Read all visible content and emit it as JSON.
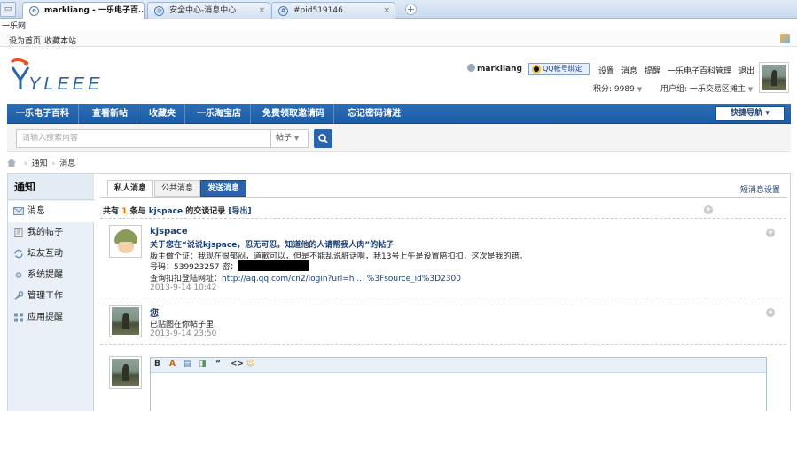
{
  "browser": {
    "tabs": [
      {
        "title": "markliang - 一乐电子百…",
        "favicon": "globe-icon"
      },
      {
        "title": "安全中心-消息中心",
        "favicon": "shield-icon"
      },
      {
        "title": "#pid519146",
        "favicon": "page-icon"
      }
    ],
    "new_tab_symbol": "+"
  },
  "site_title": "一乐网",
  "topnav": {
    "set_home": "设为首页",
    "bookmark": "收藏本站"
  },
  "logo": {
    "text": "YLEEE",
    "color": "#2a63a8",
    "accent": "#e8531f"
  },
  "user": {
    "name": "markliang",
    "qq_bind": "QQ帐号绑定",
    "links": [
      "设置",
      "消息",
      "提醒",
      "一乐电子百科管理",
      "退出"
    ],
    "points_label": "积分: 9989",
    "group_label": "用户组: 一乐交易区摊主"
  },
  "mainnav": {
    "items": [
      "一乐电子百科",
      "查看新帖",
      "收藏夹",
      "一乐淘宝店",
      "免费领取邀请码",
      "忘记密码请进"
    ],
    "quick": "快捷导航"
  },
  "search": {
    "placeholder": "请输入搜索内容",
    "type": "帖子"
  },
  "breadcrumb": [
    "通知",
    "消息"
  ],
  "sidebar": {
    "title": "通知",
    "items": [
      "消息",
      "我的帖子",
      "坛友互动",
      "系统提醒",
      "管理工作",
      "应用提醒"
    ]
  },
  "tabs": {
    "private": "私人消息",
    "public": "公共消息",
    "send": "发送消息",
    "settings": "短消息设置"
  },
  "summary": {
    "pre": "共有 ",
    "count": "1",
    "mid": " 条与 ",
    "user": "kjspace",
    "post": " 的交谈记录",
    "export": "[导出]"
  },
  "messages": [
    {
      "author": "kjspace",
      "title": "关于您在“说说kjspace，忍无可忍，知道他的人请帮我人肉”的帖子",
      "line1": "版主做个证：我现在很郁闷，道歉可以，但是不能乱说脏话啊，我13号上午是设置陪扣扣，这次是我的错。",
      "qq_label": "号码：539923257 密：",
      "url_label": "查询扣扣登陆网址：",
      "url": "http://aq.qq.com/cn2/login?url=h ... %3Fsource_id%3D2300",
      "time": "2013-9-14 10:42"
    },
    {
      "author": "您",
      "line1": "已贴图在你帖子里.",
      "time": "2013-9-14 23:50"
    }
  ],
  "editor": {
    "tools": [
      "B",
      "A",
      "▤",
      "◨",
      "“",
      "<>",
      "☺"
    ]
  }
}
